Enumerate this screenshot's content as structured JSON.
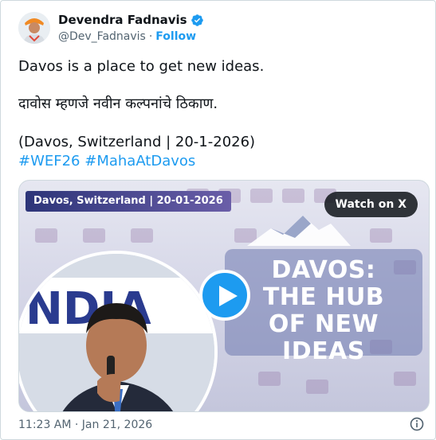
{
  "author": {
    "display_name": "Devendra Fadnavis",
    "handle": "@Dev_Fadnavis",
    "separator": "·",
    "follow_label": "Follow",
    "verified_color": "#1d9bf0"
  },
  "tweet": {
    "line1": "Davos is a place to get new ideas.",
    "line2": "दावोस म्हणजे नवीन कल्पनांचे ठिकाण.",
    "line3": "(Davos, Switzerland | 20-1-2026)",
    "hashtags": "#WEF26 #MahaAtDavos"
  },
  "media": {
    "location_tag": "Davos, Switzerland | 20-01-2026",
    "watch_label": "Watch on X",
    "headline_1": "DAVOS:",
    "headline_2": "THE HUB",
    "headline_3": "OF NEW IDEAS"
  },
  "footer": {
    "timestamp": "11:23 AM · Jan 21, 2026"
  },
  "colors": {
    "accent": "#1d9bf0",
    "text": "#0f1419",
    "muted": "#536471"
  }
}
